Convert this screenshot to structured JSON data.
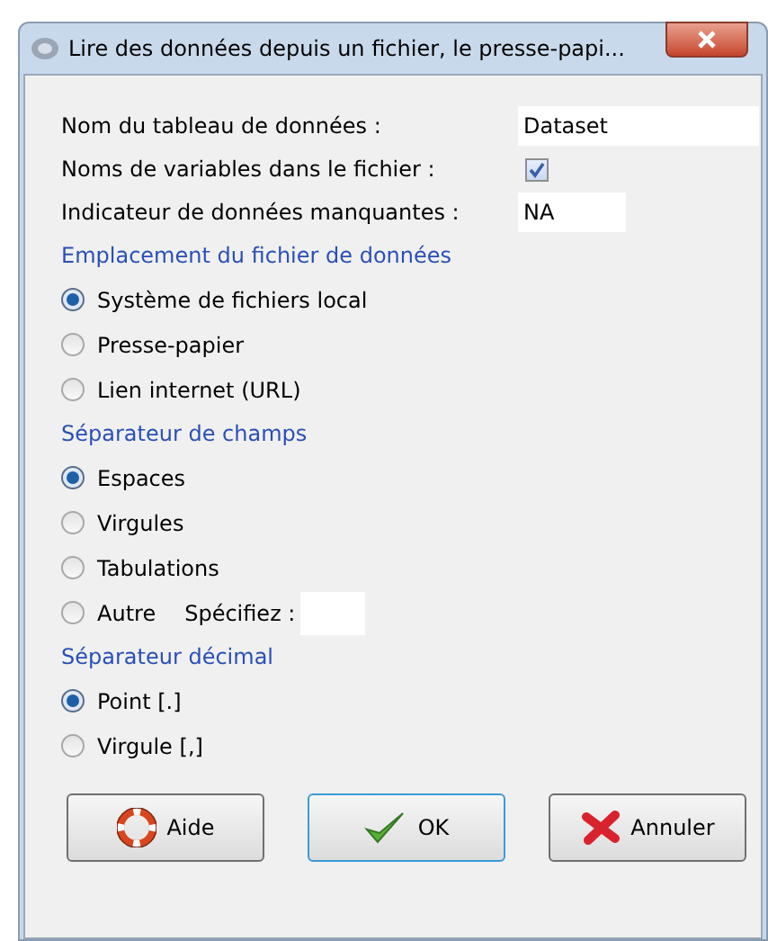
{
  "window": {
    "title": "Lire des données depuis un fichier, le presse-papi..."
  },
  "fields": [
    {
      "kind": "text",
      "label": "Nom du tableau de données :",
      "value": "Dataset"
    },
    {
      "kind": "checkbox",
      "label": "Noms de variables dans le fichier :",
      "checked": true
    },
    {
      "kind": "short",
      "label": "Indicateur de données manquantes :",
      "value": "NA"
    }
  ],
  "groups": [
    {
      "title": "Emplacement du fichier de données",
      "options": [
        {
          "label": "Système de fichiers local",
          "selected": true
        },
        {
          "label": "Presse-papier",
          "selected": false
        },
        {
          "label": "Lien internet (URL)",
          "selected": false
        }
      ]
    },
    {
      "title": "Séparateur de champs",
      "options": [
        {
          "label": "Espaces",
          "selected": true
        },
        {
          "label": "Virgules",
          "selected": false
        },
        {
          "label": "Tabulations",
          "selected": false
        },
        {
          "label": "Autre",
          "selected": false,
          "specify_label": "Spécifiez :"
        }
      ]
    },
    {
      "title": "Séparateur décimal",
      "options": [
        {
          "label": "Point [.]",
          "selected": true
        },
        {
          "label": "Virgule [,]",
          "selected": false
        }
      ]
    }
  ],
  "buttons": [
    {
      "kind": "help",
      "label": "Aide"
    },
    {
      "kind": "ok",
      "label": "OK"
    },
    {
      "kind": "cancel",
      "label": "Annuler"
    }
  ]
}
